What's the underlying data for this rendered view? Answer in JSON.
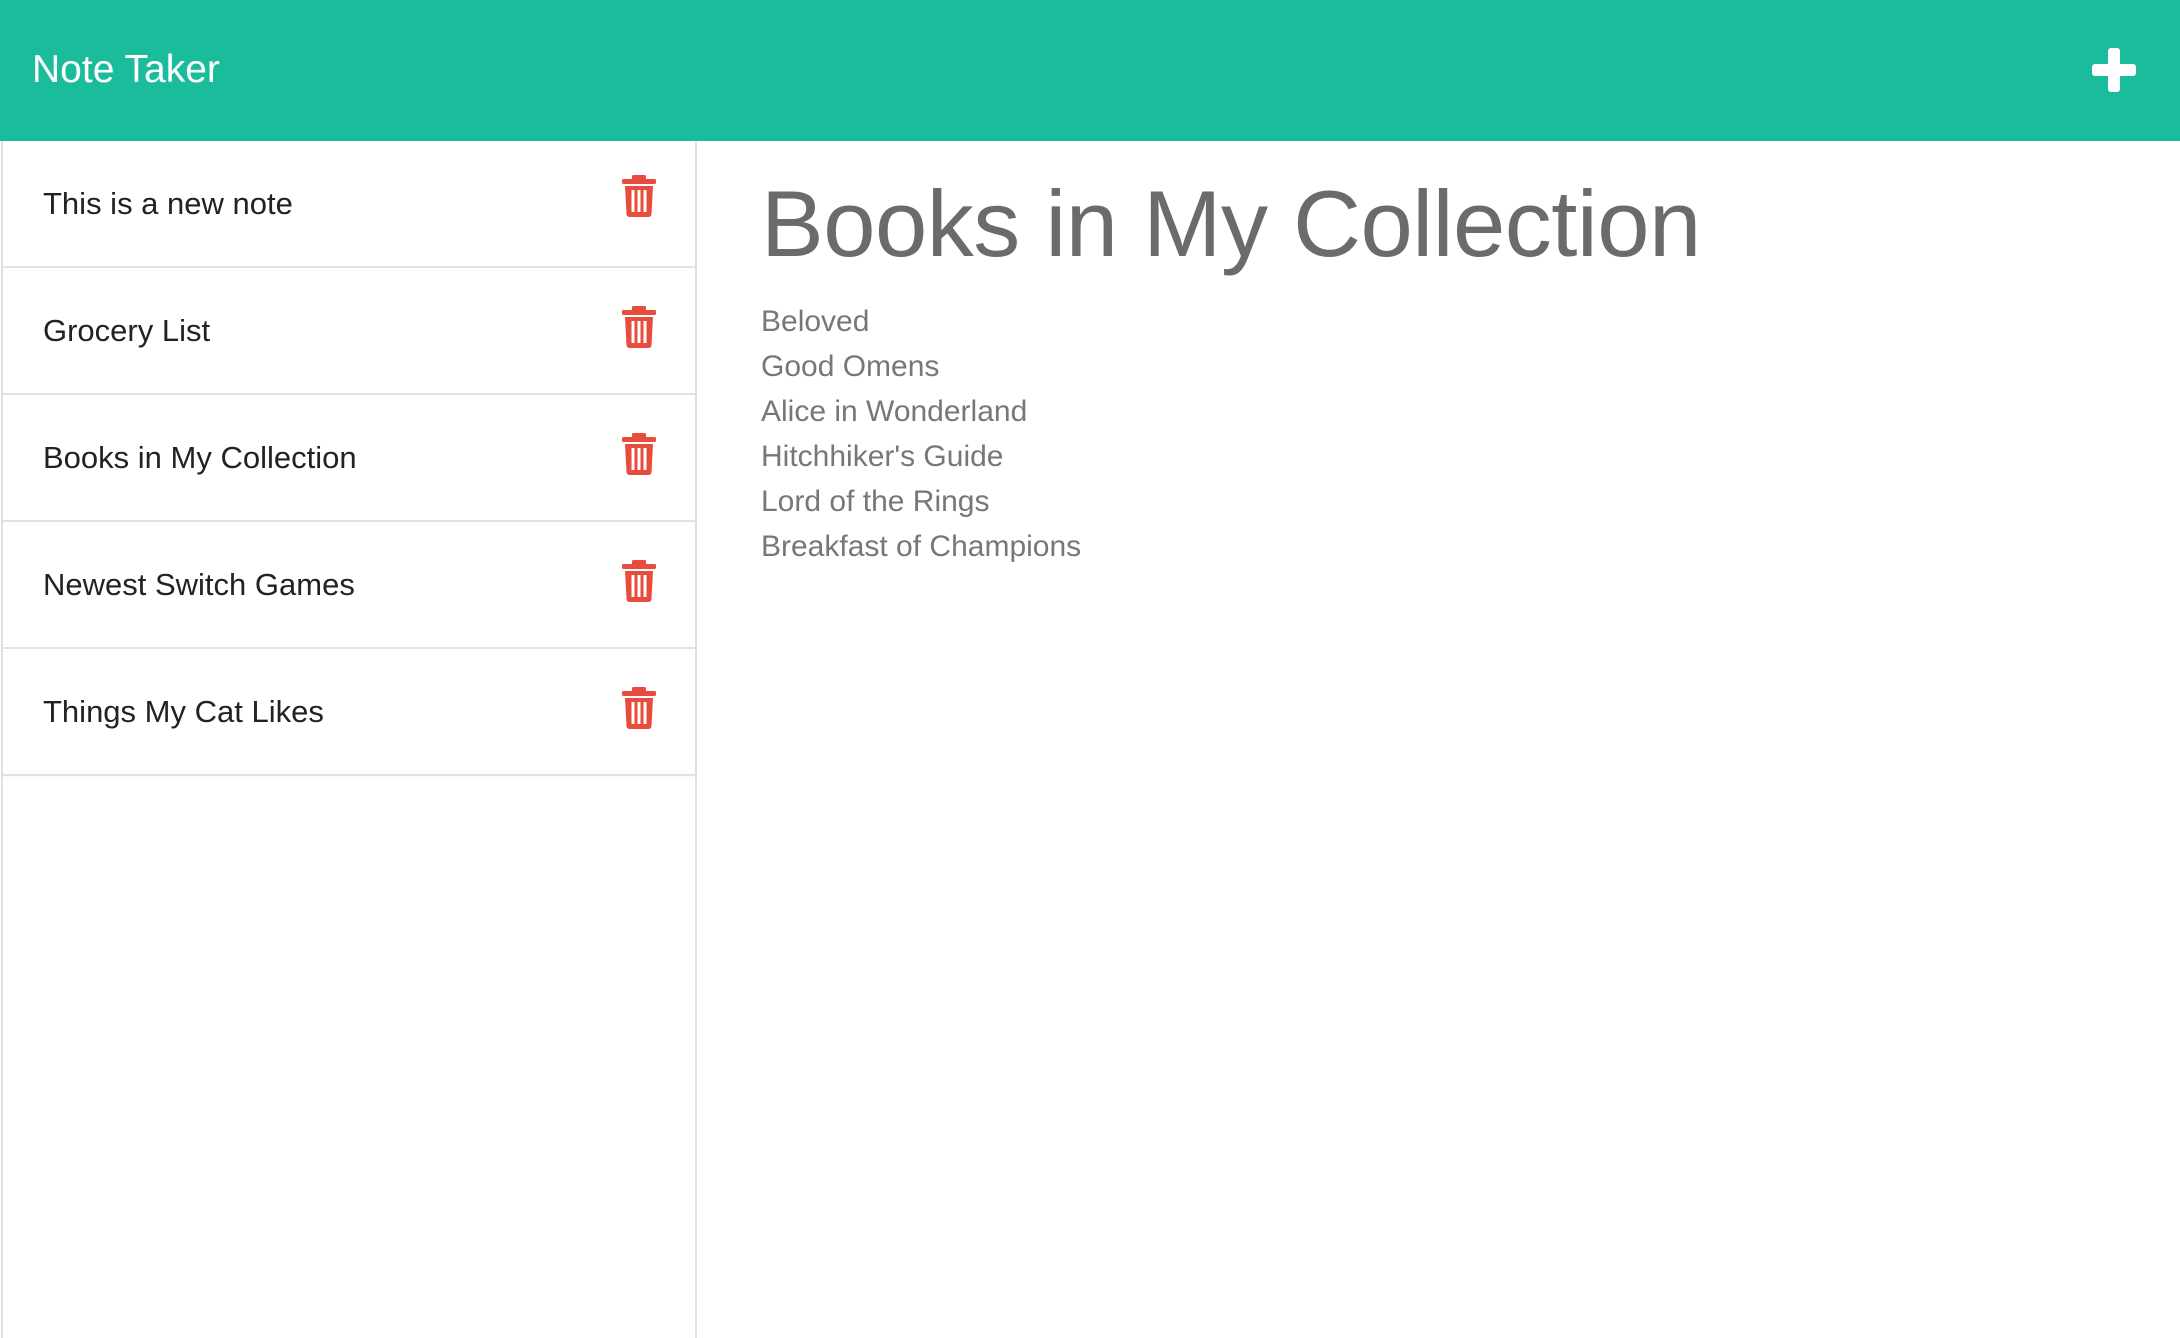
{
  "app": {
    "title": "Note Taker",
    "accent_color": "#1abc9c",
    "delete_color": "#e74c3c"
  },
  "header": {
    "add_icon": "plus-icon"
  },
  "sidebar": {
    "notes": [
      {
        "title": "This is a new note",
        "icon": "trash-icon"
      },
      {
        "title": "Grocery List",
        "icon": "trash-icon"
      },
      {
        "title": "Books in My Collection",
        "icon": "trash-icon"
      },
      {
        "title": "Newest Switch Games",
        "icon": "trash-icon"
      },
      {
        "title": "Things My Cat Likes",
        "icon": "trash-icon"
      }
    ]
  },
  "editor": {
    "title": "Books in My Collection",
    "lines": [
      "Beloved",
      "Good Omens",
      "Alice in Wonderland",
      "Hitchhiker's Guide",
      "Lord of the Rings",
      "Breakfast of Champions"
    ]
  }
}
